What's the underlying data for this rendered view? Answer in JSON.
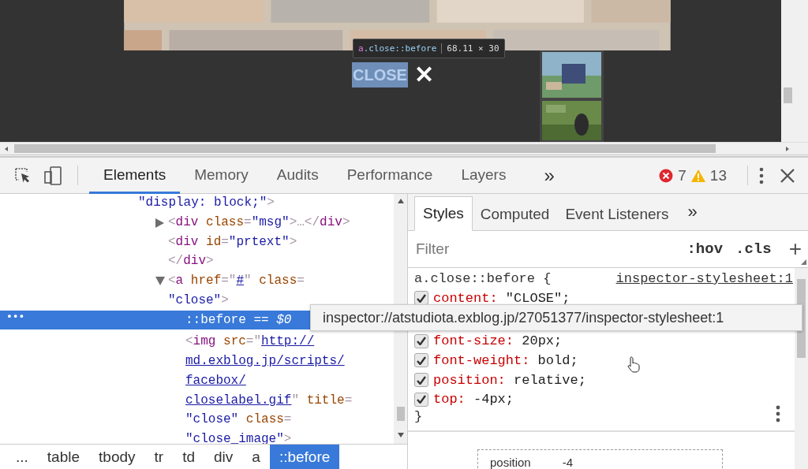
{
  "viewport": {
    "inspect_tooltip": {
      "tag": "a",
      "selector": ".close::before",
      "size": "68.11 × 30"
    },
    "close_label": "CLOSE",
    "close_glyph": "✕"
  },
  "toolbar": {
    "tabs": [
      {
        "label": "Elements",
        "selected": true
      },
      {
        "label": "Memory",
        "selected": false
      },
      {
        "label": "Audits",
        "selected": false
      },
      {
        "label": "Performance",
        "selected": false
      },
      {
        "label": "Layers",
        "selected": false
      }
    ],
    "more": "»",
    "errors": "7",
    "warnings": "13"
  },
  "dom_tree": [
    {
      "selected": false,
      "lines": [
        [
          {
            "kind": "value",
            "text": "\"display: block;\""
          },
          {
            "kind": "punct",
            "text": ">"
          }
        ]
      ],
      "children": [
        {
          "selected": false,
          "expanded": false,
          "lines": [
            [
              {
                "kind": "punct",
                "text": "<"
              },
              {
                "kind": "tag",
                "text": "div"
              },
              {
                "kind": "attr",
                "text": " class"
              },
              {
                "kind": "punct",
                "text": "="
              },
              {
                "kind": "value",
                "text": "\"msg\""
              },
              {
                "kind": "punct",
                "text": ">…</"
              },
              {
                "kind": "tag",
                "text": "div"
              },
              {
                "kind": "punct",
                "text": ">"
              }
            ]
          ]
        },
        {
          "selected": false,
          "lines": [
            [
              {
                "kind": "punct",
                "text": "<"
              },
              {
                "kind": "tag",
                "text": "div"
              },
              {
                "kind": "attr",
                "text": " id"
              },
              {
                "kind": "punct",
                "text": "="
              },
              {
                "kind": "value",
                "text": "\"prtext\""
              },
              {
                "kind": "punct",
                "text": ">"
              }
            ]
          ]
        },
        {
          "selected": false,
          "lines": [
            [
              {
                "kind": "punct",
                "text": "</"
              },
              {
                "kind": "tag",
                "text": "div"
              },
              {
                "kind": "punct",
                "text": ">"
              }
            ]
          ]
        },
        {
          "selected": false,
          "expanded": true,
          "lines": [
            [
              {
                "kind": "punct",
                "text": "<"
              },
              {
                "kind": "tag",
                "text": "a"
              },
              {
                "kind": "attr",
                "text": " href"
              },
              {
                "kind": "punct",
                "text": "=\""
              },
              {
                "kind": "link",
                "text": "#"
              },
              {
                "kind": "punct",
                "text": "\""
              },
              {
                "kind": "attr",
                "text": " class"
              },
              {
                "kind": "punct",
                "text": "="
              }
            ],
            [
              {
                "kind": "value",
                "text": "\"close\""
              },
              {
                "kind": "punct",
                "text": ">"
              }
            ]
          ],
          "children": [
            {
              "selected": true,
              "marker": "•••",
              "lines": [
                [
                  {
                    "kind": "tag",
                    "text": "::before"
                  },
                  {
                    "kind": "punct",
                    "text": " == "
                  },
                  {
                    "kind": "dollar",
                    "text": "$0"
                  }
                ]
              ]
            },
            {
              "selected": false,
              "lines": [
                [
                  {
                    "kind": "punct",
                    "text": "<"
                  },
                  {
                    "kind": "tag",
                    "text": "img"
                  },
                  {
                    "kind": "attr",
                    "text": " src"
                  },
                  {
                    "kind": "punct",
                    "text": "=\""
                  },
                  {
                    "kind": "link",
                    "text": "http://"
                  }
                ],
                [
                  {
                    "kind": "link",
                    "text": "md.exblog.jp/scripts/"
                  }
                ],
                [
                  {
                    "kind": "link",
                    "text": "facebox/"
                  }
                ],
                [
                  {
                    "kind": "link",
                    "text": "closelabel.gif"
                  },
                  {
                    "kind": "punct",
                    "text": "\""
                  },
                  {
                    "kind": "attr",
                    "text": " title"
                  },
                  {
                    "kind": "punct",
                    "text": "="
                  }
                ],
                [
                  {
                    "kind": "value",
                    "text": "\"close\""
                  },
                  {
                    "kind": "attr",
                    "text": " class"
                  },
                  {
                    "kind": "punct",
                    "text": "="
                  }
                ],
                [
                  {
                    "kind": "value",
                    "text": "\"close_image\""
                  },
                  {
                    "kind": "punct",
                    "text": ">"
                  }
                ]
              ]
            }
          ]
        }
      ]
    }
  ],
  "breadcrumbs": [
    {
      "label": "...",
      "selected": false
    },
    {
      "label": "table",
      "selected": false
    },
    {
      "label": "tbody",
      "selected": false
    },
    {
      "label": "tr",
      "selected": false
    },
    {
      "label": "td",
      "selected": false
    },
    {
      "label": "div",
      "selected": false
    },
    {
      "label": "a",
      "selected": false
    },
    {
      "label": "::before",
      "selected": true
    }
  ],
  "styles_pane": {
    "tabs": [
      {
        "label": "Styles",
        "selected": true
      },
      {
        "label": "Computed",
        "selected": false
      },
      {
        "label": "Event Listeners",
        "selected": false
      }
    ],
    "more": "»",
    "filter": {
      "placeholder": "Filter"
    },
    "toggles": [
      ":hov",
      ".cls"
    ],
    "add": "+",
    "rule": {
      "selector": "a.close::before {",
      "source": "inspector-stylesheet:1",
      "declarations": [
        {
          "property": "content:",
          "value": " \"CLOSE\";",
          "checked": true
        },
        {
          "property": "font-size:",
          "value": " 20px;",
          "checked": true
        },
        {
          "property": "font-weight:",
          "value": " bold;",
          "checked": true
        },
        {
          "property": "position:",
          "value": " relative;",
          "checked": true
        },
        {
          "property": "top:",
          "value": " -4px;",
          "checked": true
        }
      ],
      "close_brace": "}"
    },
    "box_model": {
      "label": "position",
      "value": "-4"
    }
  },
  "link_tooltip": "inspector://atstudiota.exblog.jp/27051377/inspector-stylesheet:1"
}
